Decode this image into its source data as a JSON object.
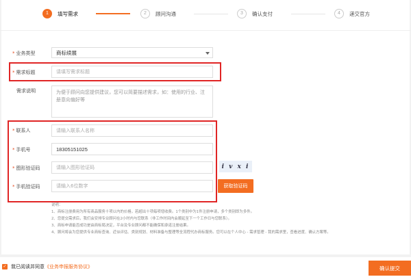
{
  "steps": [
    {
      "num": "1",
      "label": "填写需求"
    },
    {
      "num": "2",
      "label": "顾问沟通"
    },
    {
      "num": "3",
      "label": "确认支付"
    },
    {
      "num": "4",
      "label": "递交官方"
    }
  ],
  "form": {
    "business_type": {
      "label": "业务类型",
      "value": "商标续展"
    },
    "title": {
      "label": "需求标题",
      "placeholder": "请填写需求标题"
    },
    "description": {
      "label": "需求说明",
      "placeholder": "为便于顾问向您提供建议，您可以简要描述需求，如：使用的行业、注册意向偏好等"
    },
    "contact": {
      "label": "联系人",
      "placeholder": "请输入联系人名称"
    },
    "phone": {
      "label": "手机号",
      "value": "18305151025"
    },
    "captcha": {
      "label": "图形验证码",
      "placeholder": "请输入图形验证码",
      "image_text": "i v x i"
    },
    "sms": {
      "label": "手机验证码",
      "placeholder": "请输入6位数字",
      "button": "获取验证码"
    }
  },
  "notes": {
    "heading": "说明：",
    "items": [
      "1、商标注册费用为所有商品服务十项以内的价格，若超出十项每项增收费。1个类别中为1件注册申请，多个类别即为多件。",
      "2、您提交需求后，我们会安排专业顾问在2小时内与您联系（非工作时间内会顺延至下一个工作日与您联系）。",
      "3、商标申请能否成功是由商标局决定，平台及专业顾问都不能确保和承诺注册结果。",
      "4、顾问将会为您提供专业商标查询、近似评估、类别规划、材料准备与整理等全流程代办商标服务。您可以在个人中心 - 需求管理 - 我的需求里，查看进度、确认方案等。"
    ]
  },
  "footer": {
    "agree_prefix": "我已阅读并同意",
    "agree_link": "《业务申报服务协议》",
    "submit": "确认提交"
  },
  "colors": {
    "accent": "#f36d21",
    "highlight": "#e02424"
  }
}
